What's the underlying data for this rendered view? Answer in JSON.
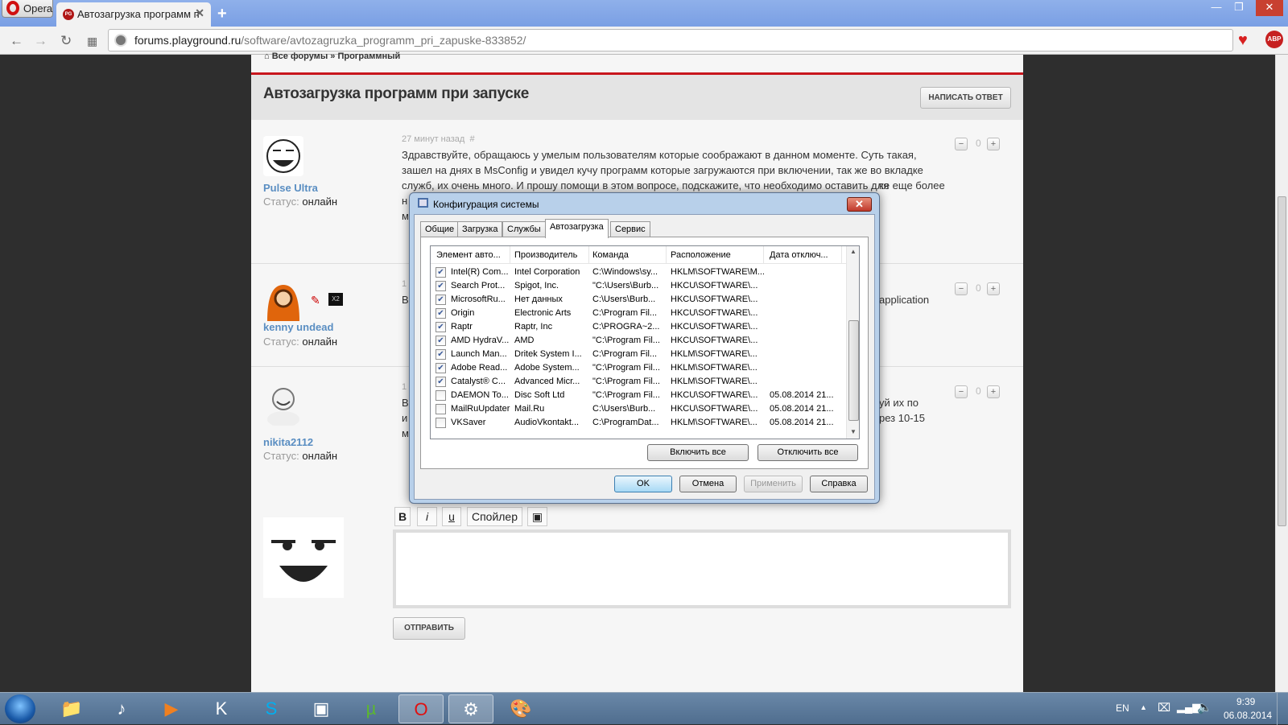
{
  "browser": {
    "menu_label": "Opera",
    "tab_title": "Автозагрузка программ п",
    "url_host": "forums.playground.ru",
    "url_path": "/software/avtozagruzka_programm_pri_zapuske-833852/",
    "favicon_text": "PG"
  },
  "forum": {
    "breadcrumb": "Все форумы » Программный",
    "topic_title": "Автозагрузка программ при запуске",
    "reply_button": "НАПИСАТЬ ОТВЕТ",
    "status_label": "Статус:",
    "posts": [
      {
        "user": "Pulse Ultra",
        "status": "онлайн",
        "time": "27 минут назад",
        "hash": "#",
        "lines": [
          "Здравствуйте, обращаюсь у умелым пользователям которые соображают в данном моменте. Суть такая,",
          "зашел на днях в MsConfig и увидел кучу программ которые загружаются при включении, так же во вкладке",
          "служб, их очень много. И прошу помощи в этом вопросе, подскажите, что необходимо оставить для",
          "н",
          "м"
        ],
        "line4_tail": "ке еще более",
        "votes": "0"
      },
      {
        "user": "kenny undead",
        "status": "онлайн",
        "time": "1",
        "lines": [
          "В"
        ],
        "tail": "application",
        "votes": "0"
      },
      {
        "user": "nikita2112",
        "status": "онлайн",
        "time": "1",
        "lines": [
          "В",
          "и",
          "м"
        ],
        "tail1": "уй их по",
        "tail2": "рез 10-15",
        "votes": "0"
      }
    ],
    "editor": {
      "bold": "B",
      "italic": "i",
      "underline": "u",
      "spoiler": "Спойлер",
      "send": "ОТПРАВИТЬ"
    }
  },
  "dialog": {
    "title": "Конфигурация системы",
    "tabs": [
      "Общие",
      "Загрузка",
      "Службы",
      "Автозагрузка",
      "Сервис"
    ],
    "active_tab": 3,
    "columns": [
      "Элемент авто...",
      "Производитель",
      "Команда",
      "Расположение",
      "Дата отключ..."
    ],
    "rows": [
      {
        "c": true,
        "n": "Intel(R) Com...",
        "m": "Intel Corporation",
        "cmd": "C:\\Windows\\sy...",
        "loc": "HKLM\\SOFTWARE\\M...",
        "d": ""
      },
      {
        "c": true,
        "n": "Search Prot...",
        "m": "Spigot, Inc.",
        "cmd": "\"C:\\Users\\Burb...",
        "loc": "HKCU\\SOFTWARE\\...",
        "d": ""
      },
      {
        "c": true,
        "n": "MicrosoftRu...",
        "m": "Нет данных",
        "cmd": "C:\\Users\\Burb...",
        "loc": "HKCU\\SOFTWARE\\...",
        "d": ""
      },
      {
        "c": true,
        "n": "Origin",
        "m": "Electronic Arts",
        "cmd": "C:\\Program Fil...",
        "loc": "HKCU\\SOFTWARE\\...",
        "d": ""
      },
      {
        "c": true,
        "n": "Raptr",
        "m": "Raptr, Inc",
        "cmd": "C:\\PROGRA~2...",
        "loc": "HKCU\\SOFTWARE\\...",
        "d": ""
      },
      {
        "c": true,
        "n": "AMD HydraV...",
        "m": "AMD",
        "cmd": "\"C:\\Program Fil...",
        "loc": "HKCU\\SOFTWARE\\...",
        "d": ""
      },
      {
        "c": true,
        "n": "Launch Man...",
        "m": "Dritek System I...",
        "cmd": "C:\\Program Fil...",
        "loc": "HKLM\\SOFTWARE\\...",
        "d": ""
      },
      {
        "c": true,
        "n": "Adobe Read...",
        "m": "Adobe System...",
        "cmd": "\"C:\\Program Fil...",
        "loc": "HKLM\\SOFTWARE\\...",
        "d": ""
      },
      {
        "c": true,
        "n": "Catalyst® C...",
        "m": "Advanced Micr...",
        "cmd": "\"C:\\Program Fil...",
        "loc": "HKLM\\SOFTWARE\\...",
        "d": ""
      },
      {
        "c": false,
        "n": "DAEMON To...",
        "m": "Disc Soft Ltd",
        "cmd": "\"C:\\Program Fil...",
        "loc": "HKCU\\SOFTWARE\\...",
        "d": "05.08.2014 21..."
      },
      {
        "c": false,
        "n": "MailRuUpdater",
        "m": "Mail.Ru",
        "cmd": "C:\\Users\\Burb...",
        "loc": "HKCU\\SOFTWARE\\...",
        "d": "05.08.2014 21..."
      },
      {
        "c": false,
        "n": "VKSaver",
        "m": "AudioVkontakt...",
        "cmd": "C:\\ProgramDat...",
        "loc": "HKLM\\SOFTWARE\\...",
        "d": "05.08.2014 21..."
      }
    ],
    "enable_all": "Включить все",
    "disable_all": "Отключить все",
    "ok": "OK",
    "cancel": "Отмена",
    "apply": "Применить",
    "help": "Справка"
  },
  "taskbar": {
    "lang": "EN",
    "time": "9:39",
    "date": "06.08.2014",
    "apps": [
      "file-explorer",
      "audio-player",
      "media-player",
      "k-app",
      "skype",
      "kmplayer",
      "utorrent",
      "opera",
      "msconfig",
      "paint"
    ],
    "active": [
      "opera",
      "msconfig"
    ]
  }
}
